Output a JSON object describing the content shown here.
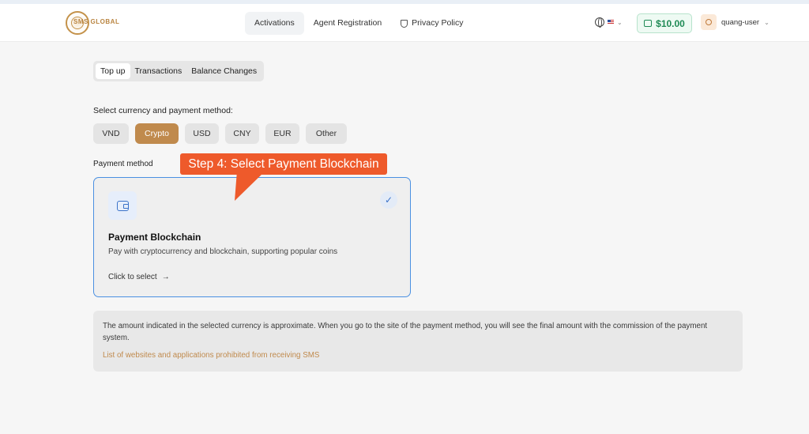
{
  "logo": {
    "text": "SMS GLOBAL"
  },
  "nav": {
    "items": [
      {
        "label": "Activations",
        "active": true
      },
      {
        "label": "Agent Registration",
        "active": false
      },
      {
        "label": "Privacy Policy",
        "active": false,
        "icon": "shield-icon"
      }
    ]
  },
  "header": {
    "language_icon": "globe-icon",
    "flag": "us-flag",
    "balance": "$10.00",
    "username": "quang-user"
  },
  "tabs": [
    {
      "label": "Top up",
      "active": true
    },
    {
      "label": "Transactions",
      "active": false
    },
    {
      "label": "Balance Changes",
      "active": false
    }
  ],
  "currency": {
    "label": "Select currency and payment method:",
    "options": [
      {
        "label": "VND",
        "active": false
      },
      {
        "label": "Crypto",
        "active": true
      },
      {
        "label": "USD",
        "active": false
      },
      {
        "label": "CNY",
        "active": false
      },
      {
        "label": "EUR",
        "active": false
      },
      {
        "label": "Other",
        "active": false
      }
    ]
  },
  "payment": {
    "label": "Payment method",
    "callout": "Step 4: Select Payment Blockchain",
    "card": {
      "title": "Payment Blockchain",
      "description": "Pay with cryptocurrency and blockchain, supporting popular coins",
      "action": "Click to select",
      "selected": true
    }
  },
  "notice": {
    "text": "The amount indicated in the selected currency is approximate. When you go to the site of the payment method, you will see the final amount with the commission of the payment system.",
    "link": "List of websites and applications prohibited from receiving SMS"
  },
  "colors": {
    "accent": "#c08a4d",
    "selection": "#4a90e2",
    "balance": "#1f8a55",
    "callout": "#ee5a2b"
  }
}
